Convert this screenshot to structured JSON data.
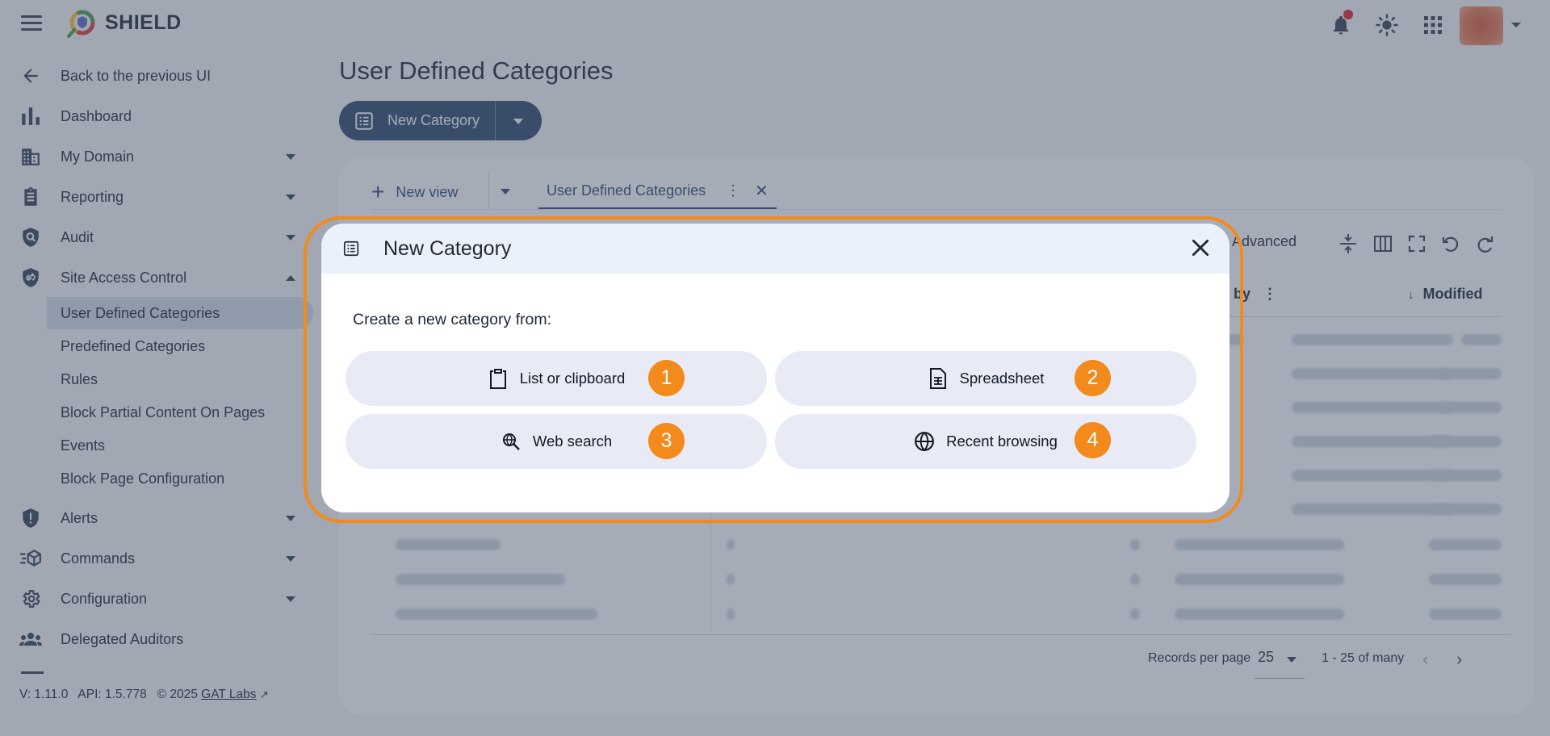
{
  "app": {
    "brand": "SHIELD"
  },
  "sidebar": {
    "back": "Back to the previous UI",
    "items": [
      {
        "label": "Dashboard",
        "icon": "bar-chart-icon"
      },
      {
        "label": "My Domain",
        "icon": "building-icon"
      },
      {
        "label": "Reporting",
        "icon": "clipboard-icon"
      },
      {
        "label": "Audit",
        "icon": "shield-search-icon"
      },
      {
        "label": "Site Access Control",
        "icon": "shield-link-icon"
      }
    ],
    "sub_items": [
      "User Defined Categories",
      "Predefined Categories",
      "Rules",
      "Block Partial Content On Pages",
      "Events",
      "Block Page Configuration"
    ],
    "items_after": [
      {
        "label": "Alerts",
        "icon": "shield-alert-icon"
      },
      {
        "label": "Commands",
        "icon": "commands-icon"
      },
      {
        "label": "Configuration",
        "icon": "gear-icon"
      },
      {
        "label": "Delegated Auditors",
        "icon": "group-icon"
      }
    ],
    "footer": {
      "version": "V: 1.11.0",
      "api": "API: 1.5.778",
      "copyright": "© 2025",
      "link": "GAT Labs"
    }
  },
  "main": {
    "title": "User Defined Categories",
    "new_category_button": "New Category",
    "tabs": {
      "new_view": "New view",
      "active": "User Defined Categories"
    },
    "toolbar": {
      "advanced": "Advanced"
    },
    "columns": {
      "modified_by": "l by",
      "modified": "Modified"
    },
    "pager": {
      "records_label": "Records per page",
      "records_value": "25",
      "range": "1 - 25 of many"
    }
  },
  "modal": {
    "title": "New Category",
    "subtitle": "Create a new category from:",
    "options": [
      {
        "label": "List or clipboard",
        "icon": "clipboard-icon",
        "badge": "1"
      },
      {
        "label": "Spreadsheet",
        "icon": "spreadsheet-icon",
        "badge": "2"
      },
      {
        "label": "Web search",
        "icon": "web-search-icon",
        "badge": "3"
      },
      {
        "label": "Recent browsing",
        "icon": "globe-icon",
        "badge": "4"
      }
    ]
  },
  "colors": {
    "primary": "#2f4a6e",
    "highlight": "#f28a1c",
    "notification": "#dc2626"
  }
}
